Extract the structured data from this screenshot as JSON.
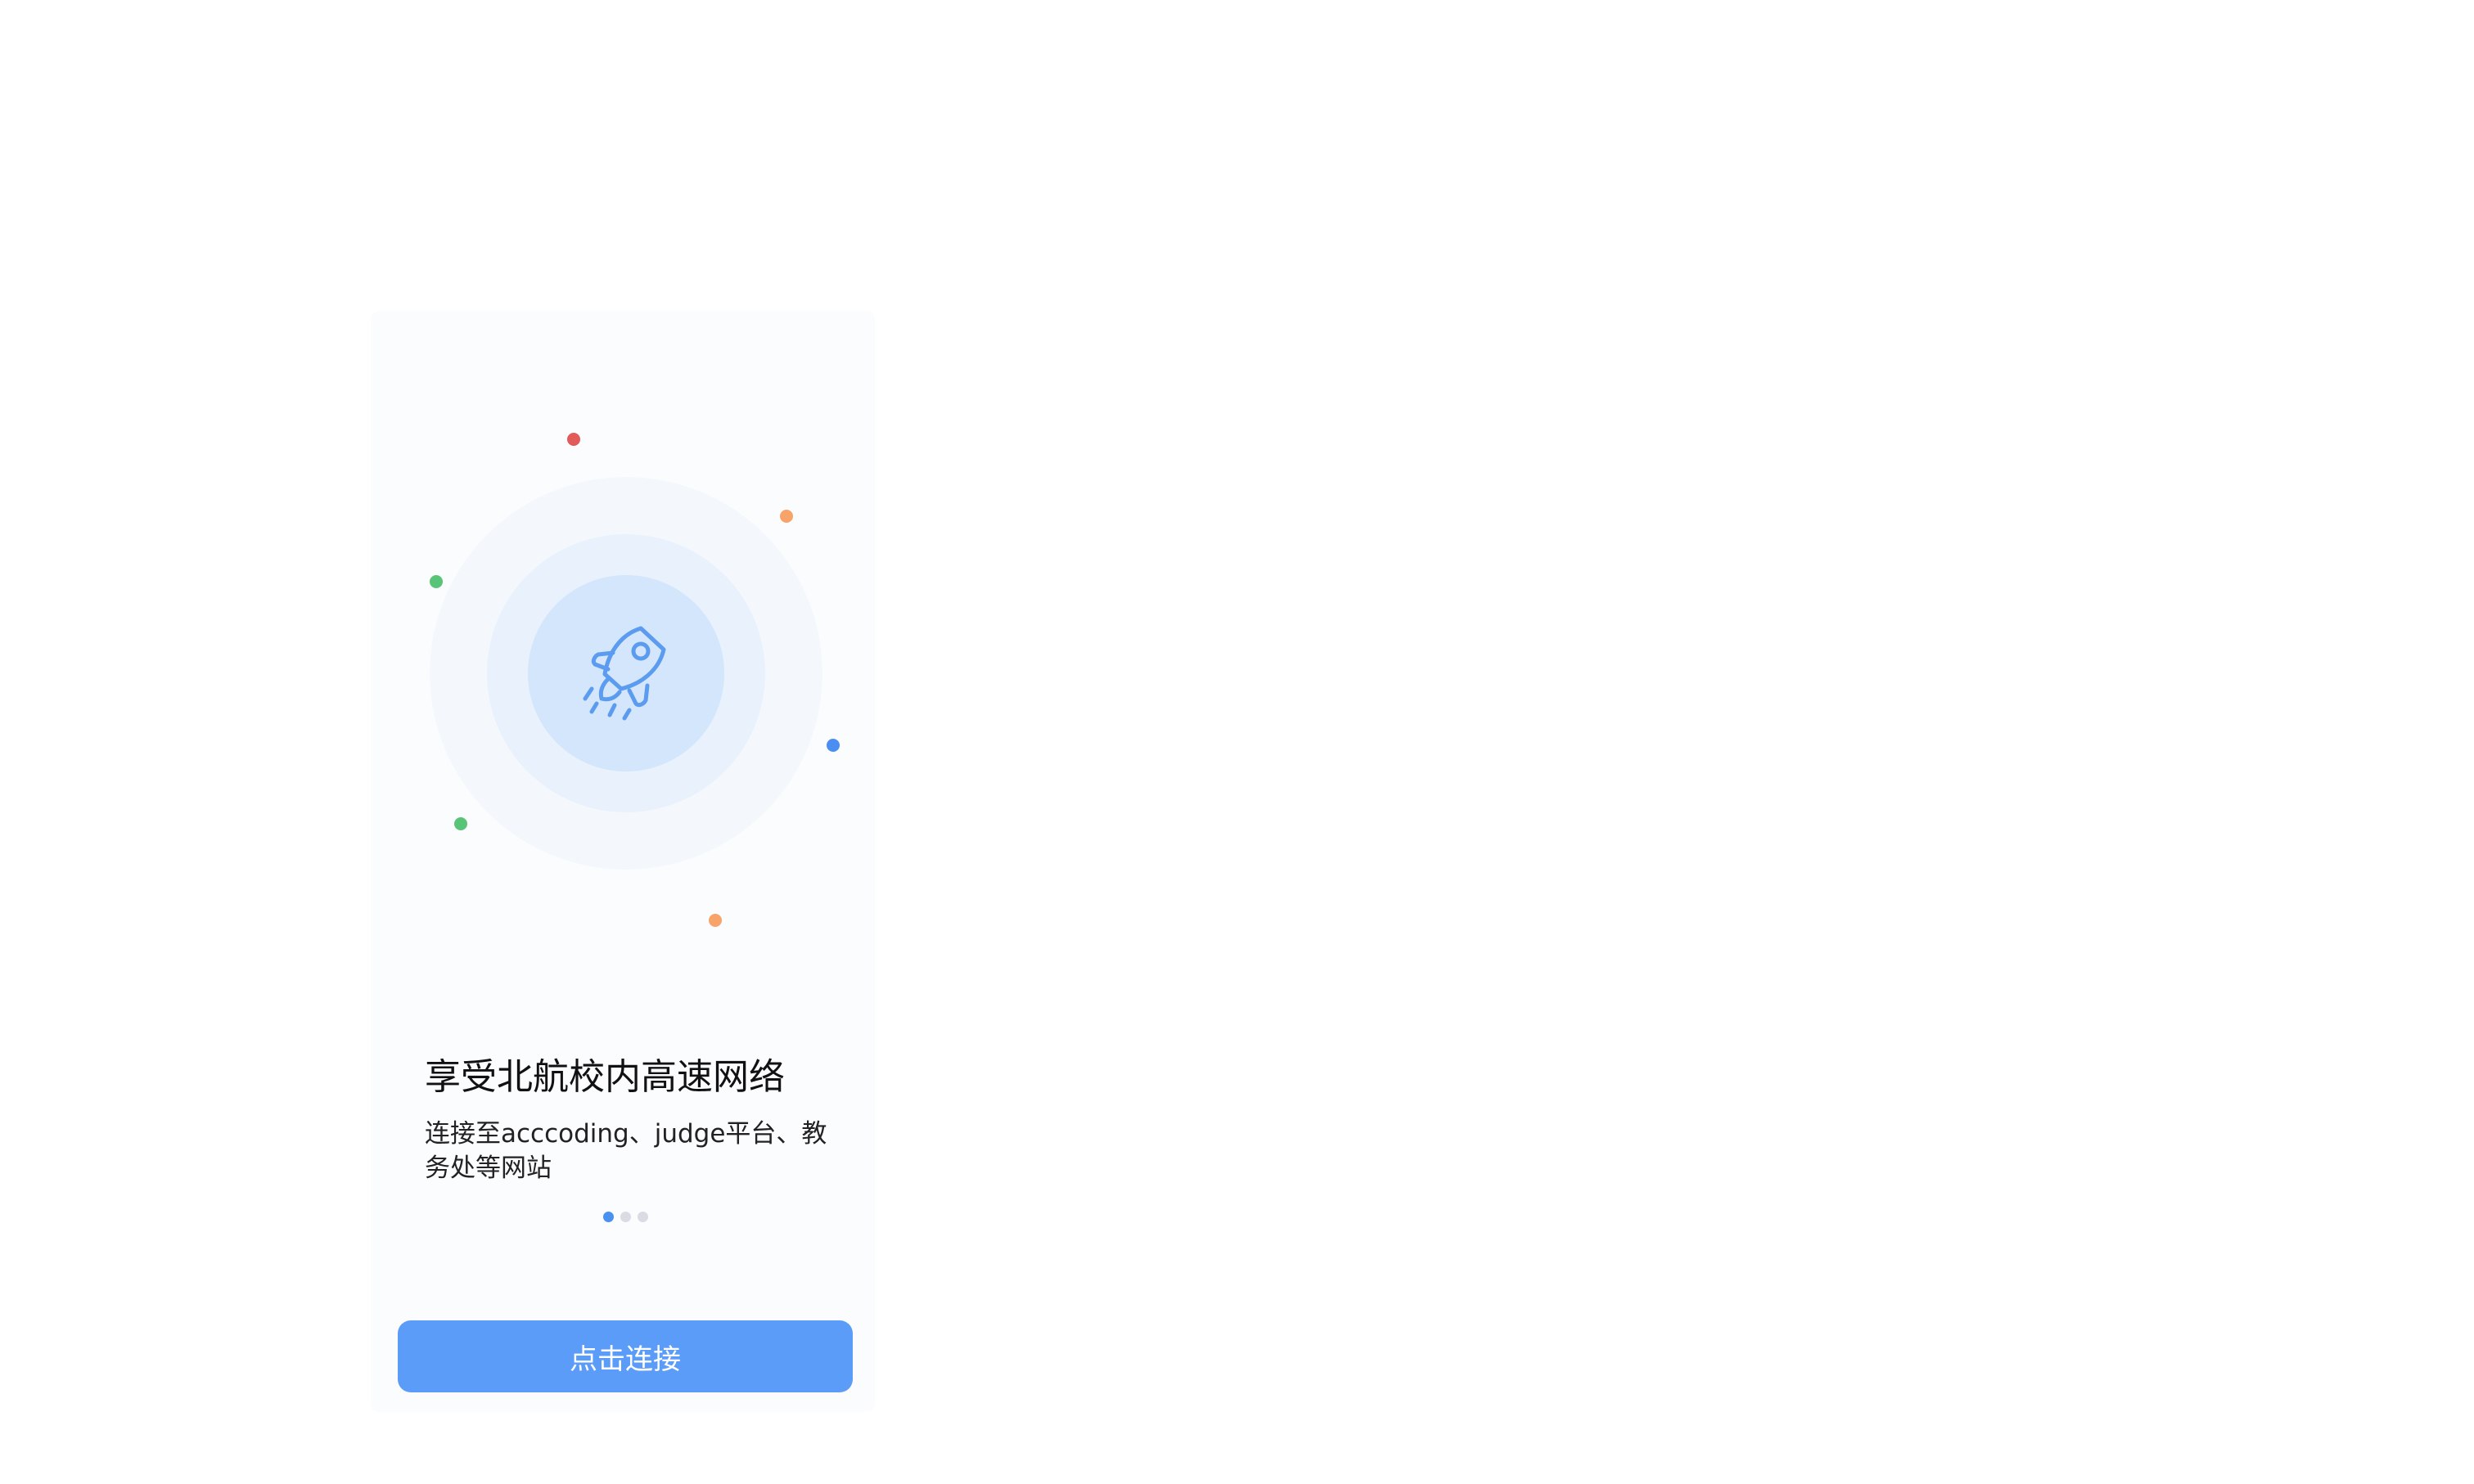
{
  "welcome": {
    "title": "享受北航校内高速网络",
    "subtitle": "连接至acccoding、judge平台、教务处等网站",
    "illustration_icon": "rocket-icon",
    "pager": {
      "current_page": 1,
      "total_pages": 3
    },
    "connect_button_label": "点击连接"
  },
  "colors": {
    "accent": "#5a9cf8",
    "pager_active": "#4a90f0",
    "pager_inactive": "#d9dde3",
    "dot_red": "#e25a5a",
    "dot_orange": "#f7a36a",
    "dot_green": "#58c477",
    "dot_blue": "#4a8ef2"
  }
}
